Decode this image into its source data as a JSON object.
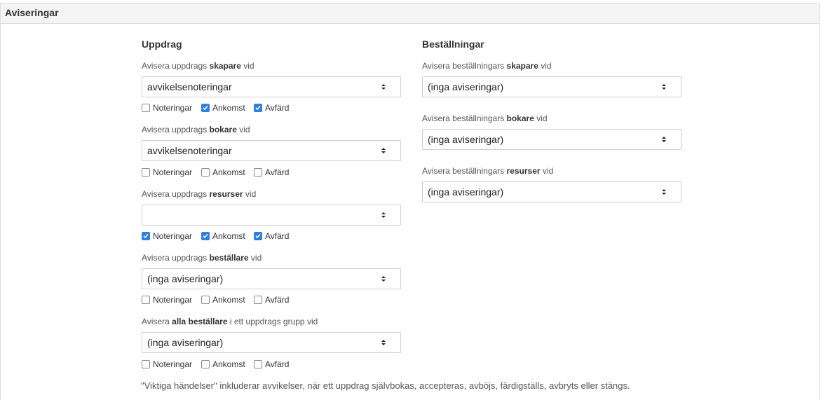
{
  "panel": {
    "title": "Aviseringar"
  },
  "left": {
    "title": "Uppdrag",
    "sections": [
      {
        "label_pre": "Avisera uppdrags ",
        "label_bold": "skapare",
        "label_post": " vid",
        "value": "avvikelsenoteringar",
        "checkboxes": [
          {
            "label": "Noteringar",
            "checked": false
          },
          {
            "label": "Ankomst",
            "checked": true
          },
          {
            "label": "Avfärd",
            "checked": true
          }
        ]
      },
      {
        "label_pre": "Avisera uppdrags ",
        "label_bold": "bokare",
        "label_post": " vid",
        "value": "avvikelsenoteringar",
        "checkboxes": [
          {
            "label": "Noteringar",
            "checked": false
          },
          {
            "label": "Ankomst",
            "checked": false
          },
          {
            "label": "Avfärd",
            "checked": false
          }
        ]
      },
      {
        "label_pre": "Avisera uppdrags ",
        "label_bold": "resurser",
        "label_post": " vid",
        "value": "",
        "checkboxes": [
          {
            "label": "Noteringar",
            "checked": true
          },
          {
            "label": "Ankomst",
            "checked": true
          },
          {
            "label": "Avfärd",
            "checked": true
          }
        ]
      },
      {
        "label_pre": "Avisera uppdrags ",
        "label_bold": "beställare",
        "label_post": " vid",
        "value": "(inga aviseringar)",
        "checkboxes": [
          {
            "label": "Noteringar",
            "checked": false
          },
          {
            "label": "Ankomst",
            "checked": false
          },
          {
            "label": "Avfärd",
            "checked": false
          }
        ]
      },
      {
        "label_pre": "Avisera ",
        "label_bold": "alla beställare",
        "label_post": " i ett uppdrags grupp vid",
        "value": "(inga aviseringar)",
        "checkboxes": [
          {
            "label": "Noteringar",
            "checked": false
          },
          {
            "label": "Ankomst",
            "checked": false
          },
          {
            "label": "Avfärd",
            "checked": false
          }
        ]
      }
    ]
  },
  "right": {
    "title": "Beställningar",
    "sections": [
      {
        "label_pre": "Avisera beställningars ",
        "label_bold": "skapare",
        "label_post": " vid",
        "value": "(inga aviseringar)"
      },
      {
        "label_pre": "Avisera beställningars ",
        "label_bold": "bokare",
        "label_post": " vid",
        "value": "(inga aviseringar)"
      },
      {
        "label_pre": "Avisera beställningars ",
        "label_bold": "resurser",
        "label_post": " vid",
        "value": "(inga aviseringar)"
      }
    ]
  },
  "footnote": "\"Viktiga händelser\" inkluderar avvikelser, när ett uppdrag självbokas, accepteras, avböjs, färdigställs, avbryts eller stängs.",
  "colors": {
    "accent": "#2f7fe0",
    "header_bg": "#f5f5f5",
    "border": "#dcdcdc"
  },
  "icons": {
    "select_caret": "updown-caret-icon",
    "checkbox_check": "check-icon"
  }
}
